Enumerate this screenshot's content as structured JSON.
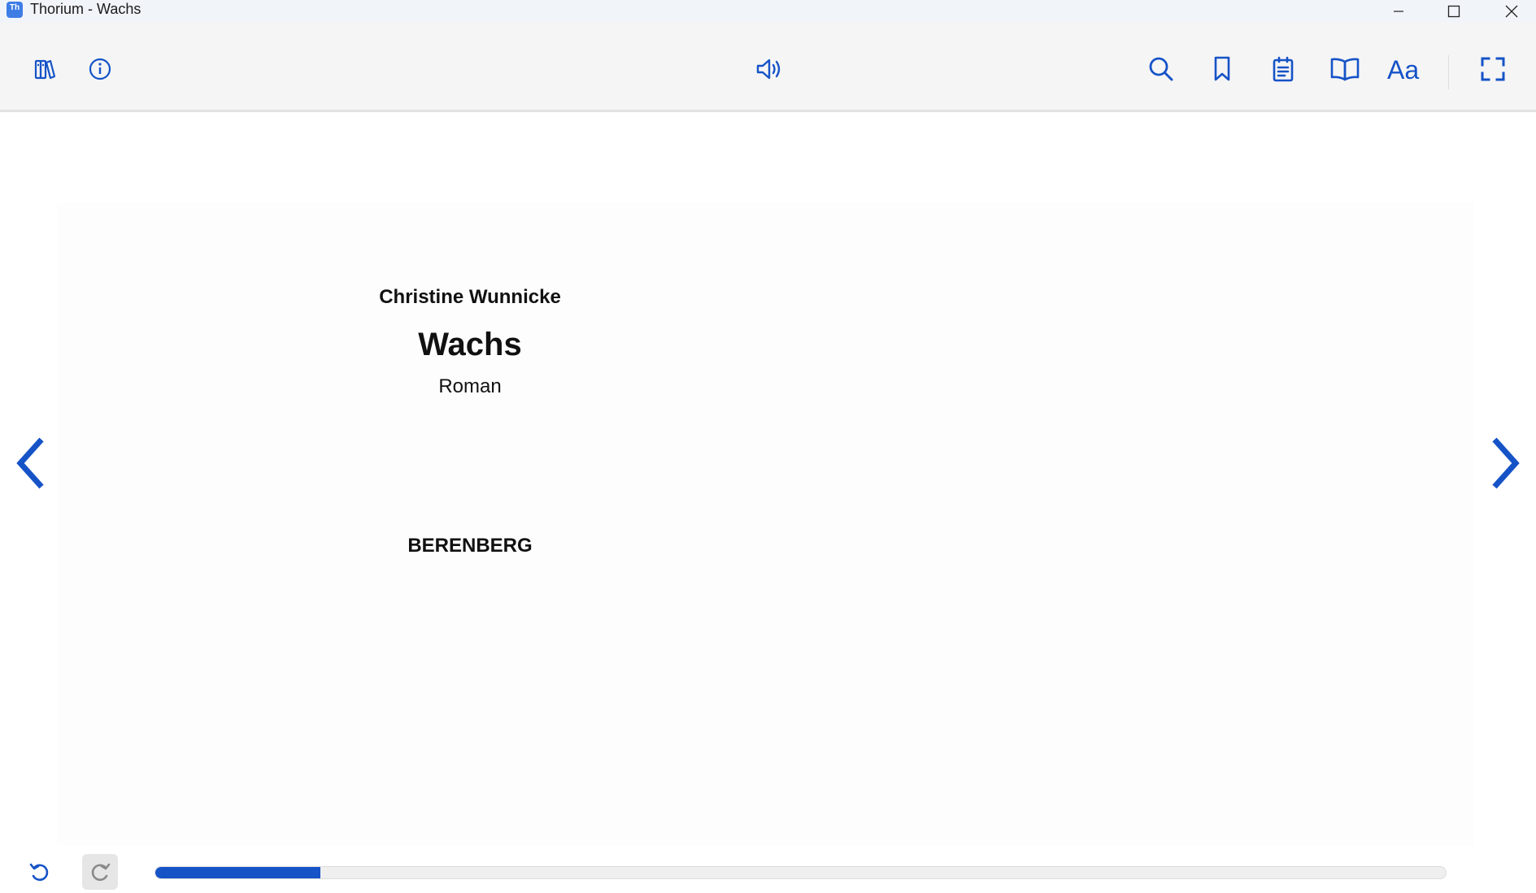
{
  "window": {
    "title": "Thorium - Wachs",
    "app_icon_label": "Th"
  },
  "toolbar": {
    "left": [
      "library-icon",
      "info-icon"
    ],
    "center": [
      "read-aloud-icon"
    ],
    "right": [
      "search-icon",
      "bookmark-icon",
      "notes-icon",
      "toc-icon",
      "text-settings-icon",
      "fullscreen-icon"
    ]
  },
  "page": {
    "author": "Christine Wunnicke",
    "title": "Wachs",
    "subtitle": "Roman",
    "publisher": "BERENBERG"
  },
  "navigation": {
    "previous": "chevron-left-icon",
    "next": "chevron-right-icon"
  },
  "progress": {
    "fraction": 0.128
  },
  "colors": {
    "accent": "#1553c7",
    "toolbar_bg": "#f5f5f5",
    "titlebar_bg": "#f1f4f9"
  }
}
